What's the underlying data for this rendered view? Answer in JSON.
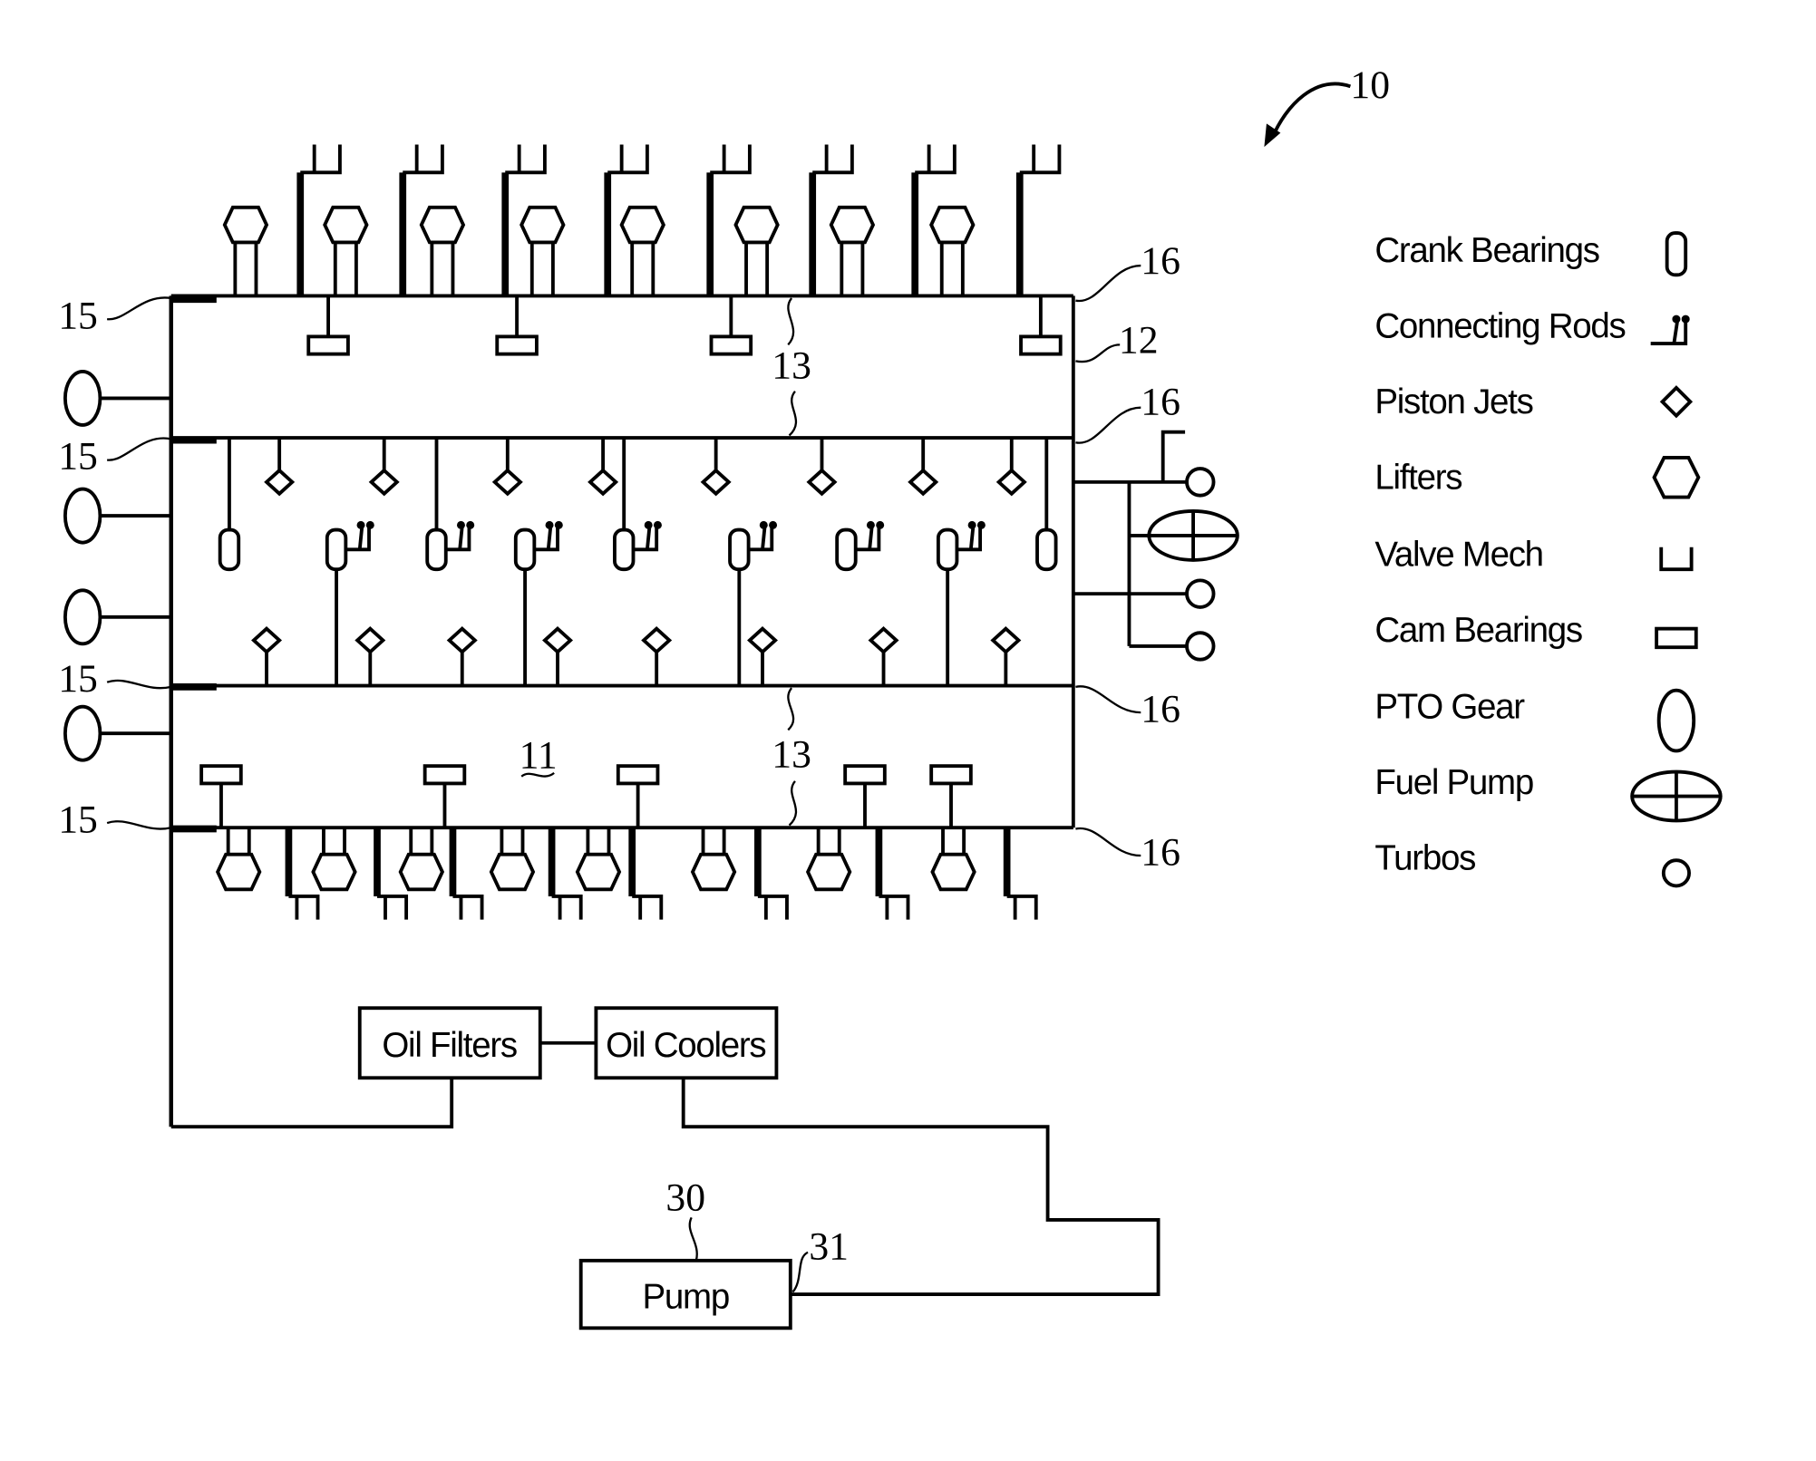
{
  "figure": {
    "reference_main": "10",
    "ref_engine_block": "11",
    "ref_oil_gallery": "12",
    "ref_break": "13",
    "ref_inlet": "15",
    "ref_outlet": "16",
    "ref_pump": "30",
    "ref_pump_outlet": "31"
  },
  "legend": {
    "items": [
      {
        "label": "Crank Bearings",
        "icon": "crank-bearing-icon"
      },
      {
        "label": "Connecting Rods",
        "icon": "connecting-rod-icon"
      },
      {
        "label": "Piston Jets",
        "icon": "piston-jet-icon"
      },
      {
        "label": "Lifters",
        "icon": "lifter-icon"
      },
      {
        "label": "Valve Mech",
        "icon": "valve-mech-icon"
      },
      {
        "label": "Cam Bearings",
        "icon": "cam-bearing-icon"
      },
      {
        "label": "PTO Gear",
        "icon": "pto-gear-icon"
      },
      {
        "label": "Fuel Pump",
        "icon": "fuel-pump-icon"
      },
      {
        "label": "Turbos",
        "icon": "turbo-icon"
      }
    ]
  },
  "flow": {
    "oil_filters": "Oil Filters",
    "oil_coolers": "Oil Coolers",
    "pump": "Pump"
  }
}
